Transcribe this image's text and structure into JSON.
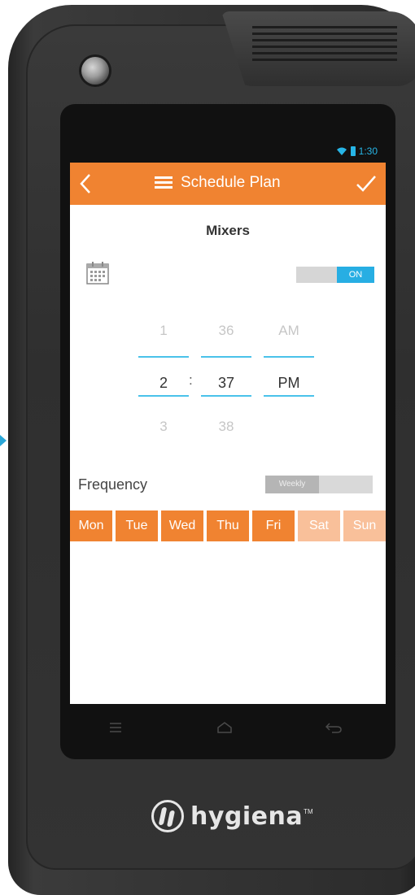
{
  "status": {
    "time": "1:30",
    "wifi_icon": "wifi-icon",
    "battery_icon": "battery-icon"
  },
  "appbar": {
    "title": "Schedule Plan",
    "back_icon": "back-chevron-icon",
    "menu_icon": "list-menu-icon",
    "confirm_icon": "checkmark-icon"
  },
  "schedule": {
    "name": "Mixers",
    "enabled_label": "ON",
    "calendar_icon": "calendar-icon"
  },
  "time_picker": {
    "hour": {
      "prev": "1",
      "selected": "2",
      "next": "3"
    },
    "separator": ":",
    "minute": {
      "prev": "36",
      "selected": "37",
      "next": "38"
    },
    "meridiem": {
      "prev": "AM",
      "selected": "PM",
      "next": ""
    }
  },
  "frequency": {
    "label": "Frequency",
    "value": "Weekly"
  },
  "days": [
    {
      "label": "Mon",
      "selected": true
    },
    {
      "label": "Tue",
      "selected": true
    },
    {
      "label": "Wed",
      "selected": true
    },
    {
      "label": "Thu",
      "selected": true
    },
    {
      "label": "Fri",
      "selected": true
    },
    {
      "label": "Sat",
      "selected": false
    },
    {
      "label": "Sun",
      "selected": false
    }
  ],
  "colors": {
    "accent": "#f08331",
    "day_selected": "#f08331",
    "day_unselected": "#f9c09a",
    "toggle_on": "#27aee3",
    "picker_line": "#4ac2ea"
  },
  "softkeys": [
    "menu-key-icon",
    "home-key-icon",
    "back-key-icon"
  ],
  "brand": {
    "name": "hygiena",
    "tm": "TM"
  }
}
